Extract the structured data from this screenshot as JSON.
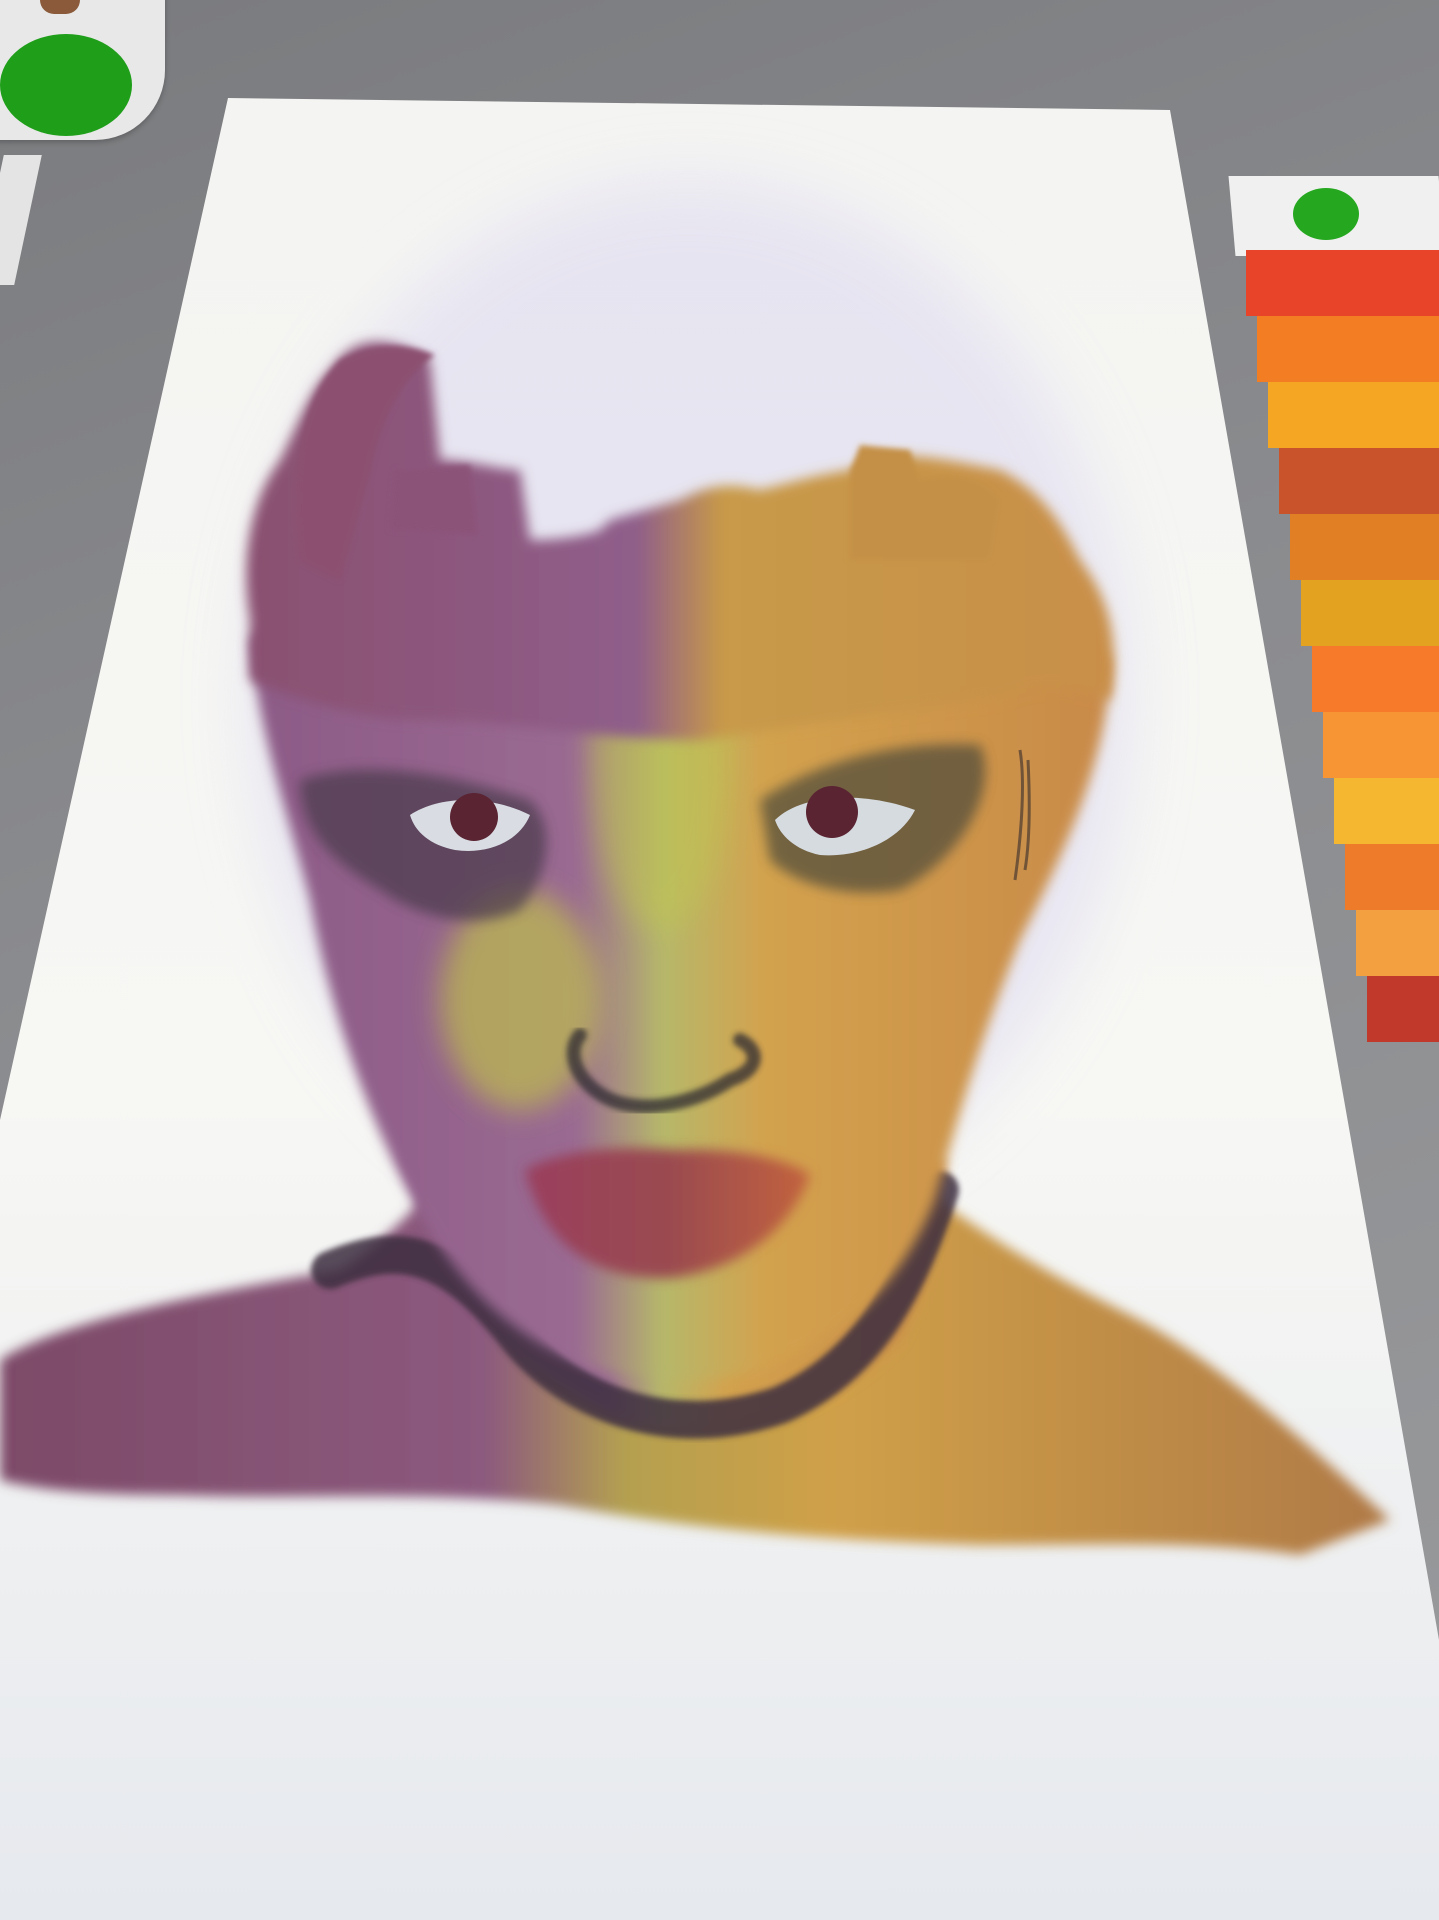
{
  "app": {
    "canvas_title": ""
  },
  "toolbar": {
    "active_color": "#1f9e1a",
    "brush_icon": "brush-icon"
  },
  "palette": {
    "selected_color": "#25a81f",
    "swatches": [
      "#e8442a",
      "#f27d22",
      "#f5a623",
      "#c9542c",
      "#e07f23",
      "#e3a21f",
      "#f7792a",
      "#f79535",
      "#f5b630",
      "#ee7b2a",
      "#f2a040",
      "#c0392b"
    ]
  },
  "painting": {
    "colors": {
      "purple": "#8c5a86",
      "ochre": "#d09a45",
      "green_glow": "#b8c84a",
      "lips": "#a04a5c",
      "dark": "#3a2a3a"
    }
  }
}
